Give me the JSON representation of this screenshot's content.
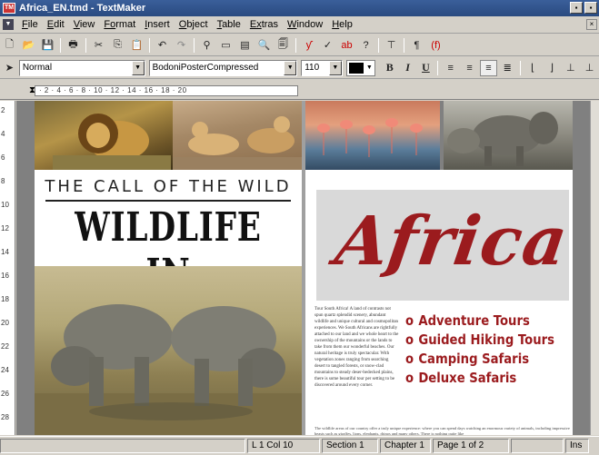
{
  "window": {
    "title": "Africa_EN.tmd - TextMaker",
    "app_icon": "TM"
  },
  "menu": {
    "items": [
      {
        "key": "F",
        "rest": "ile"
      },
      {
        "key": "E",
        "rest": "dit"
      },
      {
        "key": "V",
        "rest": "iew"
      },
      {
        "key": "Fo",
        "rest": "rmat"
      },
      {
        "key": "I",
        "rest": "nsert"
      },
      {
        "key": "O",
        "rest": "bject"
      },
      {
        "key": "T",
        "rest": "able"
      },
      {
        "key": "Ex",
        "rest": "tras"
      },
      {
        "key": "W",
        "rest": "indow"
      },
      {
        "key": "H",
        "rest": "elp"
      }
    ]
  },
  "toolbar": {
    "paragraph_style": "Normal",
    "font": "BodoniPosterCompressed",
    "zoom": "110",
    "bold": "B",
    "italic": "I",
    "underline": "U"
  },
  "ruler": {
    "marks": "· 2 · 4 · 6 · 8 · 10 · 12 · 14 · 16 · 18 · 20"
  },
  "vruler": [
    "2",
    "4",
    "6",
    "8",
    "10",
    "12",
    "14",
    "16",
    "18",
    "20",
    "22",
    "24",
    "26",
    "28"
  ],
  "document": {
    "heading": "THE CALL OF THE WILD",
    "wildlife": "WILDLIFE IN",
    "africa": "Africa",
    "tours": [
      "Adventure Tours",
      "Guided Hiking Tours",
      "Camping Safaris",
      "Deluxe Safaris"
    ],
    "tour_bullet": "o",
    "body_text": "Tour South Africa! A land of contrasts not spun quartz splendid scenery, abundant wildlife and unique cultural and cosmopolitan experiences. We South Africans are rightfully attached to our land and we whole heart to the ownership of the mountains or the lands to take from them our wonderful beaches. Our natural heritage is truly spectacular. With vegetation zones ranging from searching desert to tangled forests, or snow-clad mountains to steady deser-bedecked plains, there is some beautiful tour per setting to be discovered around every corner.",
    "footnote": "The wildlife areas of our country offer a truly unique experience: where you can spend days watching an enormous variety of animals, including impressive beasts such as giraffes, lions, elephants, rhinos and many others. There is nothing quite like"
  },
  "status": {
    "position": "L 1 Col 10",
    "section": "Section 1",
    "chapter": "Chapter 1",
    "page": "Page 1 of 2",
    "mode": "Ins"
  },
  "colors": {
    "accent_red": "#9b1b1e",
    "titlebar": "#2a4a80"
  }
}
